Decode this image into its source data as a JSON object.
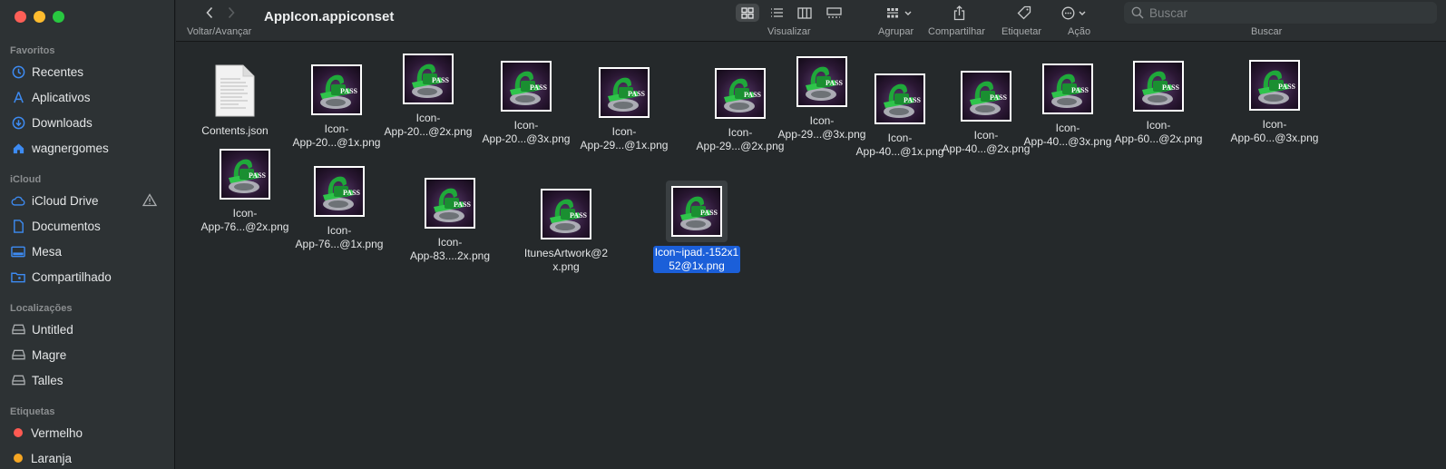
{
  "window": {
    "title": "AppIcon.appiconset"
  },
  "toolbar": {
    "nav_label": "Voltar/Avançar",
    "view_label": "Visualizar",
    "group_label": "Agrupar",
    "share_label": "Compartilhar",
    "tag_label": "Etiquetar",
    "action_label": "Ação",
    "search_label": "Buscar",
    "search_placeholder": "Buscar"
  },
  "sidebar": {
    "favorites_title": "Favoritos",
    "favorites": [
      {
        "label": "Recentes",
        "icon": "clock-icon"
      },
      {
        "label": "Aplicativos",
        "icon": "apps-icon"
      },
      {
        "label": "Downloads",
        "icon": "download-icon"
      },
      {
        "label": "wagnergomes",
        "icon": "home-icon"
      }
    ],
    "icloud_title": "iCloud",
    "icloud": [
      {
        "label": "iCloud Drive",
        "icon": "cloud-icon"
      },
      {
        "label": "Documentos",
        "icon": "document-icon"
      },
      {
        "label": "Mesa",
        "icon": "desktop-icon"
      },
      {
        "label": "Compartilhado",
        "icon": "shared-folder-icon"
      }
    ],
    "locations_title": "Localizações",
    "locations": [
      {
        "label": "Untitled",
        "icon": "drive-icon"
      },
      {
        "label": "Magre",
        "icon": "drive-icon"
      },
      {
        "label": "Talles",
        "icon": "drive-icon"
      }
    ],
    "tags_title": "Etiquetas",
    "tags": [
      {
        "label": "Vermelho",
        "color": "#ff5a52"
      },
      {
        "label": "Laranja",
        "color": "#f5a623"
      }
    ]
  },
  "files": [
    {
      "name": "Contents.json",
      "kind": "json"
    },
    {
      "name": "Icon-\nApp-20...@1x.png",
      "kind": "png"
    },
    {
      "name": "Icon-\nApp-20...@2x.png",
      "kind": "png"
    },
    {
      "name": "Icon-\nApp-20...@3x.png",
      "kind": "png"
    },
    {
      "name": "Icon-\nApp-29...@1x.png",
      "kind": "png"
    },
    {
      "name": "Icon-\nApp-29...@2x.png",
      "kind": "png"
    },
    {
      "name": "Icon-\nApp-29...@3x.png",
      "kind": "png"
    },
    {
      "name": "Icon-\nApp-40...@1x.png",
      "kind": "png"
    },
    {
      "name": "Icon-\nApp-40...@2x.png",
      "kind": "png"
    },
    {
      "name": "Icon-\nApp-40...@3x.png",
      "kind": "png"
    },
    {
      "name": "Icon-\nApp-60...@2x.png",
      "kind": "png"
    },
    {
      "name": "Icon-\nApp-60...@3x.png",
      "kind": "png"
    },
    {
      "name": "Icon-\nApp-76...@2x.png",
      "kind": "png"
    },
    {
      "name": "Icon-\nApp-76...@1x.png",
      "kind": "png"
    },
    {
      "name": "Icon-\nApp-83....2x.png",
      "kind": "png"
    },
    {
      "name": "ItunesArtwork@2\nx.png",
      "kind": "png"
    },
    {
      "name": "Icon~ipad.-152x1\n52@1x.png",
      "kind": "png",
      "selected": true
    }
  ],
  "thumbnail_text": "PASS",
  "colors": {
    "accent": "#1b5fd9",
    "sidebar_icon": "#3d8bf2",
    "logo_green": "#1fa83a"
  }
}
